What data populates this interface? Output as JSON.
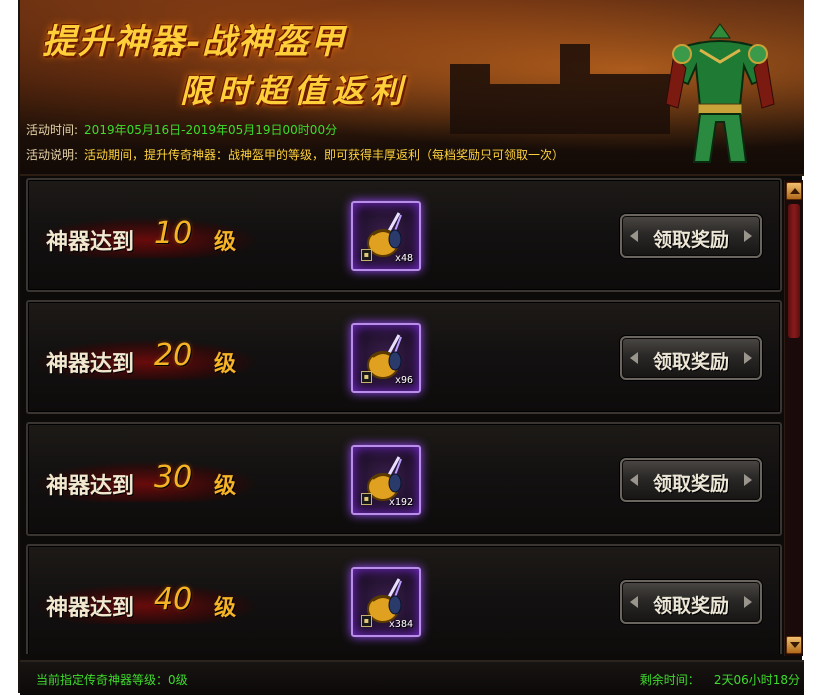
{
  "banner": {
    "title_line1": "提升神器-战神盔甲",
    "title_line2": "限时超值返利",
    "time_label": "活动时间:",
    "time_value": "2019年05月16日-2019年05月19日00时00分",
    "desc_label": "活动说明:",
    "desc_value": "活动期间，提升传奇神器：战神盔甲的等级，即可获得丰厚返利（每档奖励只可领取一次）"
  },
  "tiers": [
    {
      "prefix": "神器达到",
      "level": "10",
      "unit": "级",
      "item_icon": "gold-pouch-icon",
      "count": "x48",
      "button": "领取奖励"
    },
    {
      "prefix": "神器达到",
      "level": "20",
      "unit": "级",
      "item_icon": "gold-pouch-icon",
      "count": "x96",
      "button": "领取奖励"
    },
    {
      "prefix": "神器达到",
      "level": "30",
      "unit": "级",
      "item_icon": "gold-pouch-icon",
      "count": "x192",
      "button": "领取奖励"
    },
    {
      "prefix": "神器达到",
      "level": "40",
      "unit": "级",
      "item_icon": "gold-pouch-icon",
      "count": "x384",
      "button": "领取奖励"
    }
  ],
  "footer": {
    "current_level": "当前指定传奇神器等级：0级",
    "remaining_label": "剩余时间：",
    "remaining_value": "2天06小时18分"
  },
  "colors": {
    "title_gold": "#ffcf3a",
    "green_text": "#3edc2c",
    "yellow_text": "#ffd23c",
    "level_gold": "#f5b326",
    "item_glow": "#9b4bff"
  }
}
